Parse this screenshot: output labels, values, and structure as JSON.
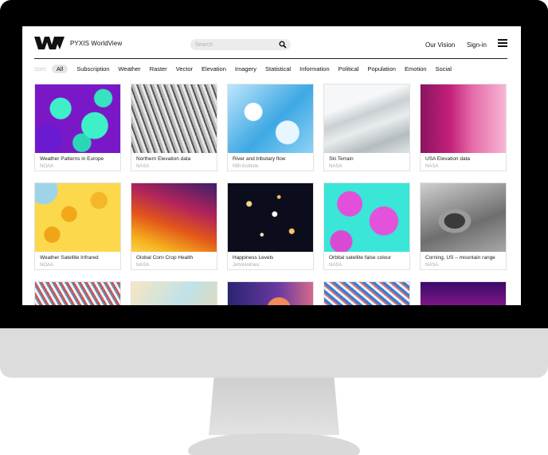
{
  "header": {
    "brand": "PYXIS WorldView",
    "search_placeholder": "Search",
    "nav": [
      "Our Vision",
      "Sign-in"
    ]
  },
  "filters": {
    "sort_label": "Sort:",
    "items": [
      "All",
      "Subscription",
      "Weather",
      "Raster",
      "Vector",
      "Elevation",
      "Imagery",
      "Statistical",
      "Information",
      "Political",
      "Population",
      "Emotion",
      "Social"
    ],
    "active": "All"
  },
  "cards": [
    {
      "title": "Weather Patterns in Europe",
      "source": "NOAA"
    },
    {
      "title": "Northern Elevation data",
      "source": "NASA"
    },
    {
      "title": "River and tributary flow",
      "source": "NBI institute"
    },
    {
      "title": "Ski Terrain",
      "source": "NASA"
    },
    {
      "title": "USA Elevation data",
      "source": "NASA"
    },
    {
      "title": "Weather Satellite Infrared",
      "source": "NOAA"
    },
    {
      "title": "Global Corn Crop Health",
      "source": "NASA"
    },
    {
      "title": "Happiness Levels",
      "source": "JohnHolmes"
    },
    {
      "title": "Orbital satellite false colour",
      "source": "NASA"
    },
    {
      "title": "Corning, US – mountain range",
      "source": "NASA"
    }
  ],
  "colors": {
    "accent_active_bg": "#e6e6e6",
    "bezel": "#000000",
    "stand": "#dcdcdc"
  }
}
